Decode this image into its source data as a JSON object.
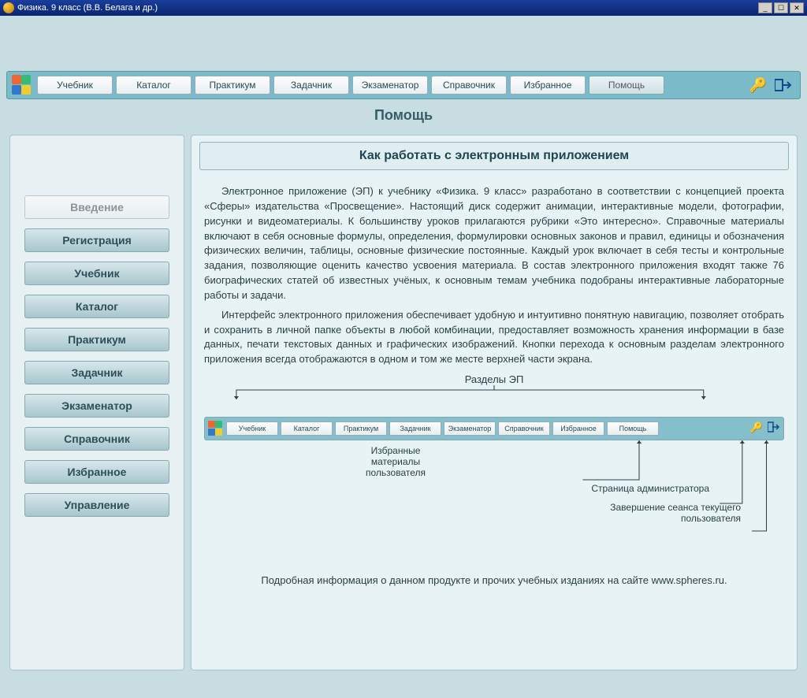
{
  "window": {
    "title": "Физика. 9 класс (В.В. Белага и др.)"
  },
  "nav": {
    "items": [
      "Учебник",
      "Каталог",
      "Практикум",
      "Задачник",
      "Экзаменатор",
      "Справочник",
      "Избранное",
      "Помощь"
    ],
    "active": "Помощь"
  },
  "subheader": "Помощь",
  "sidebar": {
    "items": [
      "Введение",
      "Регистрация",
      "Учебник",
      "Каталог",
      "Практикум",
      "Задачник",
      "Экзаменатор",
      "Справочник",
      "Избранное",
      "Управление"
    ],
    "current": "Введение"
  },
  "content": {
    "title": "Как работать с электронным приложением",
    "p1": "Электронное приложение (ЭП) к учебнику «Физика. 9 класс» разработано в соответствии с концепцией проекта «Сферы» издательства «Просвещение». Настоящий диск содержит анимации, интерактивные модели, фотографии, рисунки и видеоматериалы. К большинству уроков прилагаются рубрики «Это интересно». Справочные материалы включают в себя основные формулы, определения, формулировки основных законов и правил, единицы и обозначения физических величин, таблицы, основные физические постоянные. Каждый урок включает в себя тесты и контрольные задания, позволяющие оценить качество усвоения материала. В состав электронного приложения входят также 76 биографических статей об известных учёных, к основным темам учебника подобраны интерактивные лабораторные работы и задачи.",
    "p2": "Интерфейс электронного приложения обеспечивает удобную и интуитивно понятную навигацию, позволяет отобрать и сохранить в личной папке объекты в любой комбинации, предоставляет возможность хранения информации в базе данных, печати текстовых данных и графических изображений. Кнопки перехода к основным разделам электронного приложения всегда отображаются в одном и том же месте верхней части экрана.",
    "diagram_label": "Разделы ЭП",
    "callout1_l1": "Избранные",
    "callout1_l2": "материалы",
    "callout1_l3": "пользователя",
    "callout2": "Страница администратора",
    "callout3_l1": "Завершение сеанса текущего",
    "callout3_l2": "пользователя",
    "footer": "Подробная информация о данном продукте и прочих учебных изданиях на сайте www.spheres.ru."
  },
  "mini_nav": {
    "items": [
      "Учебник",
      "Каталог",
      "Практикум",
      "Задачник",
      "Экзаменатор",
      "Справочник",
      "Избранное",
      "Помощь"
    ]
  }
}
